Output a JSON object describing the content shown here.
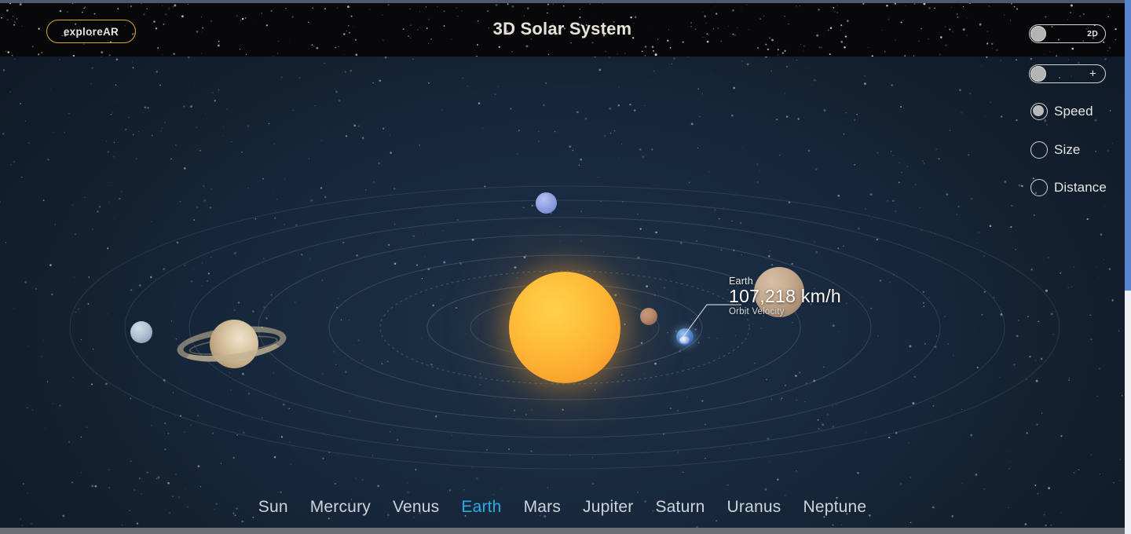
{
  "header": {
    "explore_button": "exploreAR",
    "title": "3D Solar System"
  },
  "controls": {
    "view_toggle": {
      "label": "2D",
      "state": "off"
    },
    "zoom_toggle": {
      "label": "+",
      "state": "off"
    },
    "radios": [
      {
        "label": "Speed",
        "selected": true
      },
      {
        "label": "Size",
        "selected": false
      },
      {
        "label": "Distance",
        "selected": false
      }
    ]
  },
  "callout": {
    "name": "Earth",
    "value": "107,218 km/h",
    "sub": "Orbit Velocity"
  },
  "planet_nav": {
    "items": [
      {
        "label": "Sun",
        "active": false
      },
      {
        "label": "Mercury",
        "active": false
      },
      {
        "label": "Venus",
        "active": false
      },
      {
        "label": "Earth",
        "active": true
      },
      {
        "label": "Mars",
        "active": false
      },
      {
        "label": "Jupiter",
        "active": false
      },
      {
        "label": "Saturn",
        "active": false
      },
      {
        "label": "Uranus",
        "active": false
      },
      {
        "label": "Neptune",
        "active": false
      }
    ]
  },
  "colors": {
    "accent_cyan": "#2ba9e0",
    "accent_gold": "#e0a438",
    "sun": "#ffc13c",
    "space_bg": "#16273b",
    "header_bg": "#08080a",
    "scrollbar_thumb": "#5a84cf"
  },
  "scene": {
    "bodies": [
      {
        "name": "sun",
        "label": "Sun"
      },
      {
        "name": "mars",
        "label": "Mars"
      },
      {
        "name": "earth",
        "label": "Earth"
      },
      {
        "name": "venus",
        "label": "Venus"
      },
      {
        "name": "neptune",
        "label": "Neptune"
      },
      {
        "name": "uranus",
        "label": "Uranus"
      },
      {
        "name": "saturn",
        "label": "Saturn"
      }
    ]
  }
}
